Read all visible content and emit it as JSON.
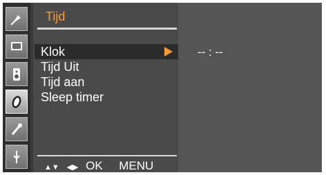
{
  "menu": {
    "title": "Tijd",
    "items": [
      {
        "label": "Klok",
        "selected": true
      },
      {
        "label": "Tijd Uit"
      },
      {
        "label": "Tijd aan"
      },
      {
        "label": "Sleep timer"
      }
    ]
  },
  "value": "-- : --",
  "nav": {
    "updown_symbol": "▲▼",
    "leftright_symbol": "◀▶",
    "ok_label": "OK",
    "menu_label": "MENU"
  },
  "icons": [
    {
      "name": "antenna-icon"
    },
    {
      "name": "screen-icon"
    },
    {
      "name": "speaker-icon"
    },
    {
      "name": "clock-icon",
      "selected": true
    },
    {
      "name": "tools-icon"
    },
    {
      "name": "input-icon"
    }
  ],
  "colors": {
    "accent": "#f39a3a",
    "menu_bg": "#4a4a4a",
    "panel_bg": "#555555"
  }
}
